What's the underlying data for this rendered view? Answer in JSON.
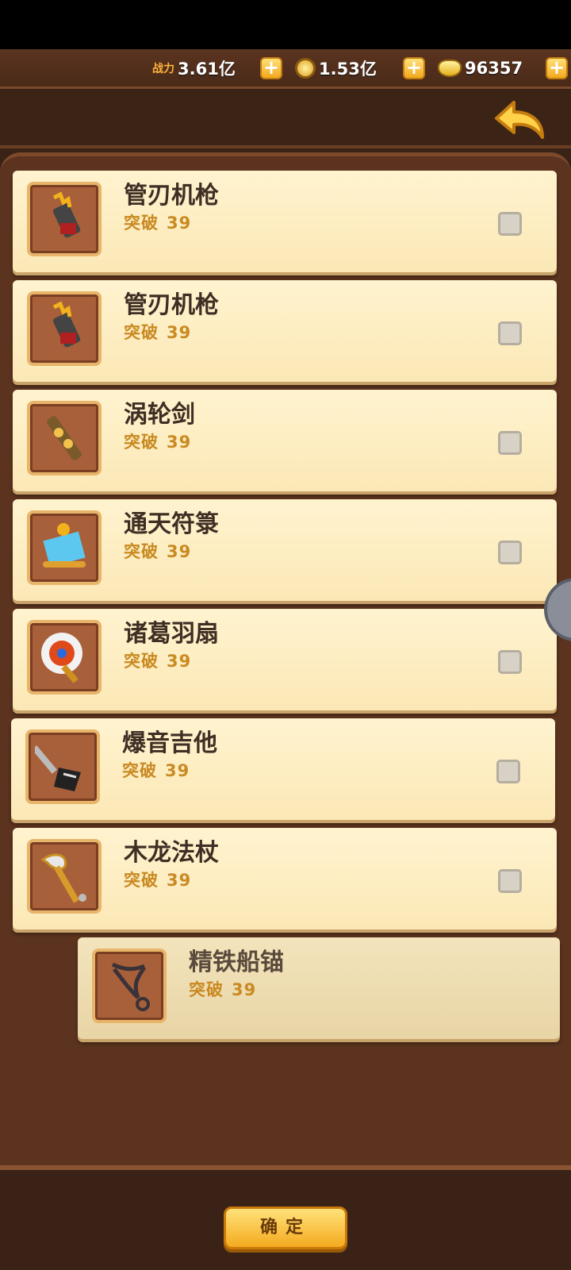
{
  "topbar": {
    "power_label": "战力",
    "power_value": "3.61亿",
    "coins_value": "1.53亿",
    "gold_value": "96357",
    "plus": "+"
  },
  "items": [
    {
      "name": "管刃机枪",
      "break_label": "突破",
      "level": "39",
      "icon": "machine-gun-icon"
    },
    {
      "name": "管刃机枪",
      "break_label": "突破",
      "level": "39",
      "icon": "machine-gun-icon"
    },
    {
      "name": "涡轮剑",
      "break_label": "突破",
      "level": "39",
      "icon": "turbine-sword-icon"
    },
    {
      "name": "通天符箓",
      "break_label": "突破",
      "level": "39",
      "icon": "talisman-scroll-icon"
    },
    {
      "name": "诸葛羽扇",
      "break_label": "突破",
      "level": "39",
      "icon": "feather-fan-icon"
    },
    {
      "name": "爆音吉他",
      "break_label": "突破",
      "level": "39",
      "icon": "electric-guitar-icon"
    },
    {
      "name": "木龙法杖",
      "break_label": "突破",
      "level": "39",
      "icon": "dragon-staff-icon"
    },
    {
      "name": "精铁船锚",
      "break_label": "突破",
      "level": "39",
      "icon": "iron-anchor-icon"
    }
  ],
  "confirm_label": "确定",
  "colors": {
    "accent": "#f4aa1f",
    "name_text": "#3f2e24",
    "sub_text": "#c98a22"
  }
}
